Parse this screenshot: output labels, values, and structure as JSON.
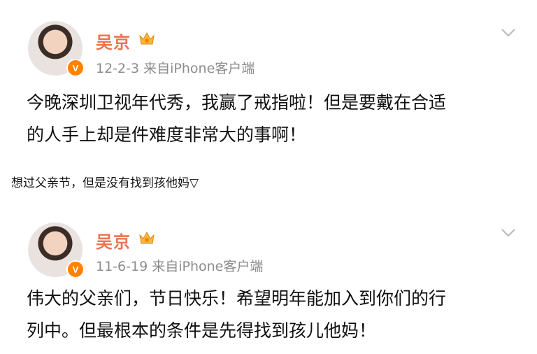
{
  "posts": [
    {
      "author": "吴京",
      "date": "12-2-3",
      "source": "来自iPhone客户端",
      "text_lines": [
        "今晚深圳卫视年代秀，我赢了戒指啦！但是要戴在合适",
        "的人手上却是件难度非常大的事啊！"
      ]
    },
    {
      "author": "吴京",
      "date": "11-6-19",
      "source": "来自iPhone客户端",
      "text_lines": [
        "伟大的父亲们，节日快乐！希望明年能加入到你们的行",
        "列中。但最根本的条件是先得找到孩儿他妈！"
      ]
    }
  ],
  "caption": "想过父亲节，但是没有找到孩他妈▽",
  "verified_badge": "V",
  "colors": {
    "name": "#eb7350",
    "badge": "#ff8200",
    "meta": "#8c8c8c"
  },
  "icons": {
    "crown": "crown-icon",
    "chevron": "chevron-down-icon",
    "verified": "verified-badge-icon"
  }
}
